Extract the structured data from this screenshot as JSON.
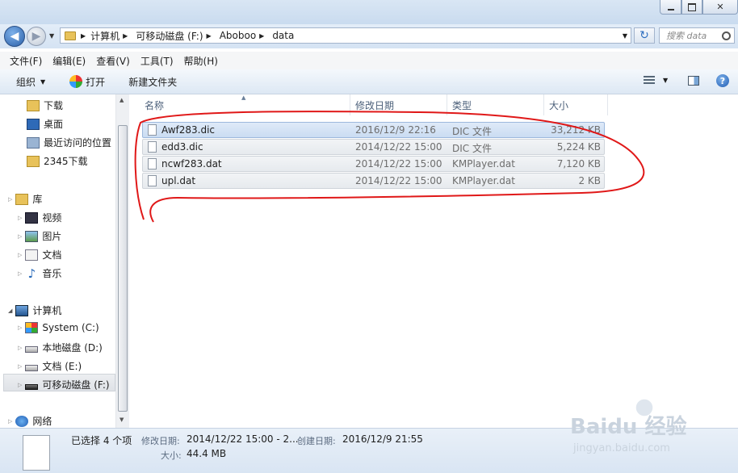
{
  "window": {
    "minimize": "□",
    "maximize": "□",
    "close": "✕"
  },
  "address": {
    "crumbs": [
      "计算机",
      "可移动磁盘 (F:)",
      "Aboboo",
      "data"
    ],
    "refresh_glyph": "↻",
    "search_placeholder": "搜索 data"
  },
  "menu": [
    "文件(F)",
    "编辑(E)",
    "查看(V)",
    "工具(T)",
    "帮助(H)"
  ],
  "toolbar": {
    "organize": "组织",
    "open": "打开",
    "new_folder": "新建文件夹"
  },
  "nav": {
    "favorites": [
      "下载",
      "桌面",
      "最近访问的位置",
      "2345下载"
    ],
    "library": {
      "label": "库",
      "items": [
        "视频",
        "图片",
        "文档",
        "音乐"
      ]
    },
    "computer": {
      "label": "计算机",
      "items": [
        "System (C:)",
        "本地磁盘 (D:)",
        "文档 (E:)",
        "可移动磁盘 (F:)"
      ]
    },
    "network": "网络"
  },
  "columns": {
    "name": "名称",
    "modified": "修改日期",
    "type": "类型",
    "size": "大小"
  },
  "files": [
    {
      "name": "Awf283.dic",
      "modified": "2016/12/9 22:16",
      "type": "DIC 文件",
      "size": "33,212 KB"
    },
    {
      "name": "edd3.dic",
      "modified": "2014/12/22 15:00",
      "type": "DIC 文件",
      "size": "5,224 KB"
    },
    {
      "name": "ncwf283.dat",
      "modified": "2014/12/22 15:00",
      "type": "KMPlayer.dat",
      "size": "7,120 KB"
    },
    {
      "name": "upl.dat",
      "modified": "2014/12/22 15:00",
      "type": "KMPlayer.dat",
      "size": "2 KB"
    }
  ],
  "status": {
    "selected": "已选择 4 个项",
    "modified_label": "修改日期:",
    "modified_value": "2014/12/22 15:00 - 2...",
    "created_label": "创建日期:",
    "created_value": "2016/12/9 21:55",
    "size_label": "大小:",
    "size_value": "44.4 MB"
  },
  "watermark": {
    "brand": "Baidu 经验",
    "url": "jingyan.baidu.com"
  },
  "colors": {
    "annotation": "#e01818",
    "selection": "#cadcf2",
    "folder": "#e8c25a"
  }
}
